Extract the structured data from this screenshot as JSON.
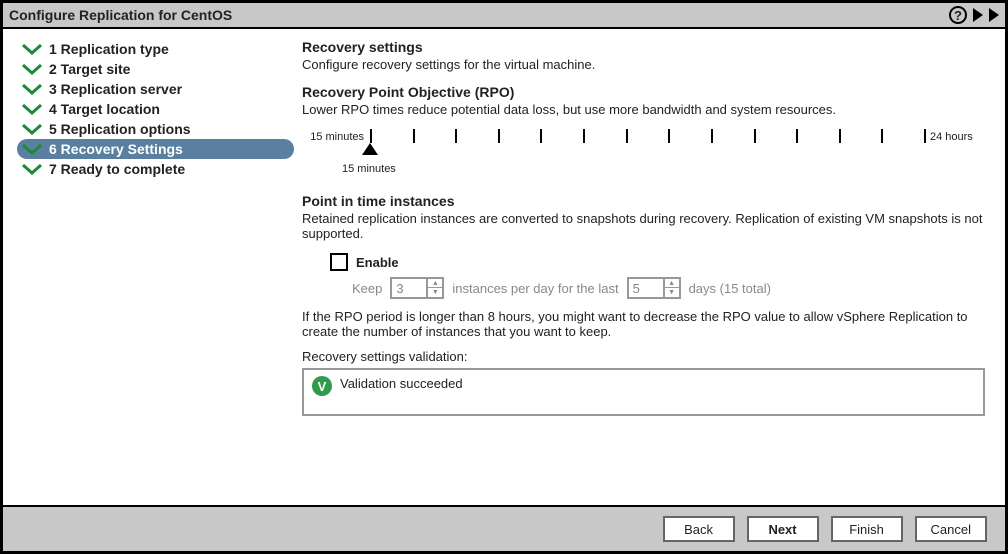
{
  "title": "Configure Replication for CentOS",
  "steps": [
    {
      "num": "1",
      "label": "Replication type",
      "completed": true,
      "current": false
    },
    {
      "num": "2",
      "label": "Target site",
      "completed": true,
      "current": false
    },
    {
      "num": "3",
      "label": "Replication server",
      "completed": true,
      "current": false
    },
    {
      "num": "4",
      "label": "Target location",
      "completed": true,
      "current": false
    },
    {
      "num": "5",
      "label": "Replication options",
      "completed": true,
      "current": false
    },
    {
      "num": "6",
      "label": "Recovery Settings",
      "completed": true,
      "current": true
    },
    {
      "num": "7",
      "label": "Ready to complete",
      "completed": true,
      "current": false
    }
  ],
  "recovery": {
    "heading": "Recovery settings",
    "desc": "Configure recovery settings for the virtual machine."
  },
  "rpo": {
    "heading": "Recovery Point Objective (RPO)",
    "desc": "Lower RPO times reduce potential data loss, but use more bandwidth and system resources.",
    "min_label": "15 minutes",
    "max_label": "24 hours",
    "value_label": "15 minutes",
    "tick_count": 14,
    "thumb_position_percent": 0
  },
  "pit": {
    "heading": "Point in time instances",
    "desc": "Retained replication instances are converted to snapshots during recovery. Replication of existing VM snapshots is not supported.",
    "enable_label": "Enable",
    "enabled": false,
    "keep_label": "Keep",
    "instances_per_day": "3",
    "mid_text": "instances per day for the last",
    "days": "5",
    "suffix_text": "days (15 total)",
    "note": "If the RPO period is longer than 8 hours, you might want to decrease the RPO value to allow vSphere Replication to create the number of instances that you want to keep."
  },
  "validation": {
    "label": "Recovery settings validation:",
    "status_text": "Validation succeeded",
    "status_ok": true
  },
  "footer": {
    "back": "Back",
    "next": "Next",
    "finish": "Finish",
    "cancel": "Cancel"
  },
  "colors": {
    "accent_step": "#5a7fa0",
    "check_chevron": "#1a8a3a",
    "ok_badge": "#2e9c4a"
  }
}
